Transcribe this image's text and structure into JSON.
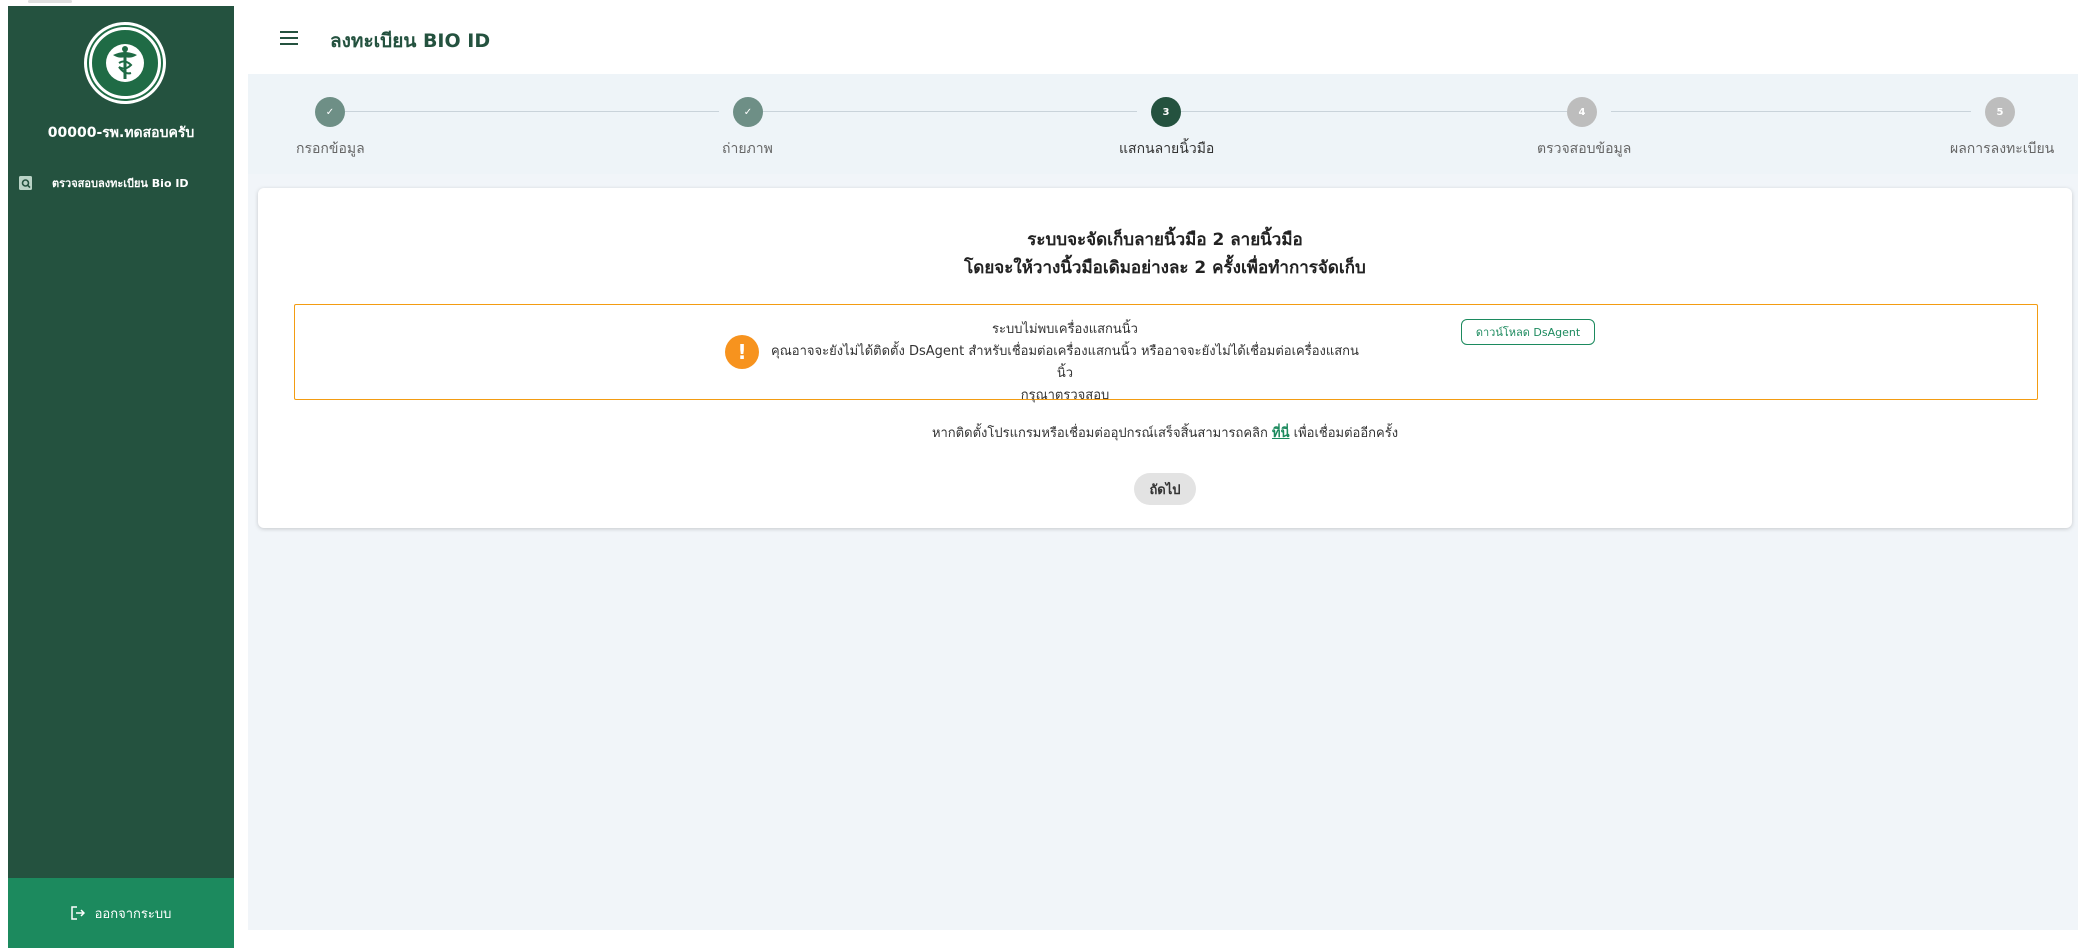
{
  "sidebar": {
    "hospital_name": "00000-รพ.ทดสอบครับ",
    "nav": [
      {
        "label": "ตรวจสอบลงทะเบียน Bio ID",
        "icon": "search-document-icon"
      }
    ],
    "logout_label": "ออกจากระบบ",
    "logout_icon": "logout-icon",
    "logo_icon": "ministry-of-public-health-seal"
  },
  "header": {
    "menu_icon": "hamburger-menu-icon",
    "title": "ลงทะเบียน BIO ID"
  },
  "stepper": {
    "current_step": 3,
    "steps": [
      {
        "number": "✓",
        "label": "กรอกข้อมูล",
        "status": "done"
      },
      {
        "number": "✓",
        "label": "ถ่ายภาพ",
        "status": "done"
      },
      {
        "number": "3",
        "label": "แสกนลายนิ้วมือ",
        "status": "active"
      },
      {
        "number": "4",
        "label": "ตรวจสอบข้อมูล",
        "status": "pending"
      },
      {
        "number": "5",
        "label": "ผลการลงทะเบียน",
        "status": "pending"
      }
    ]
  },
  "card": {
    "title_line1": "ระบบจะจัดเก็บลายนิ้วมือ 2 ลายนิ้วมือ",
    "title_line2": "โดยจะให้วางนิ้วมือเดิมอย่างละ 2 ครั้งเพื่อทำการจัดเก็บ",
    "alert": {
      "icon": "warning-icon",
      "line1": "ระบบไม่พบเครื่องแสกนนิ้ว",
      "line2": "คุณอาจจะยังไม่ได้ติดตั้ง DsAgent สำหรับเชื่อมต่อเครื่องแสกนนิ้ว หรืออาจจะยังไม่ได้เชื่อมต่อเครื่องแสกนนิ้ว",
      "line3": "กรุณาตรวจสอบ",
      "download_label": "ดาวน์โหลด DsAgent"
    },
    "hint_before": "หากติดตั้งโปรแกรมหรือเชื่อมต่ออุปกรณ์เสร็จสิ้นสามารถคลิก",
    "hint_link": "ที่นี่",
    "hint_after": "เพื่อเชื่อมต่ออีกครั้ง",
    "next_label": "ถัดไป"
  },
  "colors": {
    "sidebar": "#24523f",
    "accent": "#1c8a5e",
    "step_done": "#6e8f86",
    "step_active": "#24523f",
    "step_pending": "#bdbdbd",
    "warning": "#f7931e"
  }
}
